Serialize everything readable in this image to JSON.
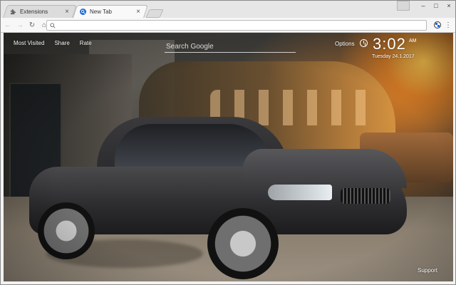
{
  "browser": {
    "tabs": [
      {
        "label": "Extensions",
        "icon": "puzzle-icon",
        "active": false
      },
      {
        "label": "New Tab",
        "icon": "newtab-search-icon",
        "active": true
      }
    ],
    "close_glyph": "×",
    "window_controls": {
      "minimize": "–",
      "maximize": "□",
      "close": "×"
    }
  },
  "toolbar": {
    "back": "←",
    "forward": "→",
    "reload": "↻",
    "home": "⌂",
    "address_value": "",
    "menu": "⋮",
    "extension_icon": "bmw-logo-icon"
  },
  "newtab": {
    "nav": {
      "most_visited": "Most Visited",
      "share": "Share",
      "rate": "Rate"
    },
    "search_placeholder": "Search Google",
    "options_label": "Options",
    "clock": {
      "time": "3:02",
      "ampm": "AM",
      "date": "Tuesday 24.1.2017"
    },
    "support_label": "Support"
  },
  "colors": {
    "accent_blue": "#1c69d4",
    "overlay_text": "#ffffff"
  }
}
